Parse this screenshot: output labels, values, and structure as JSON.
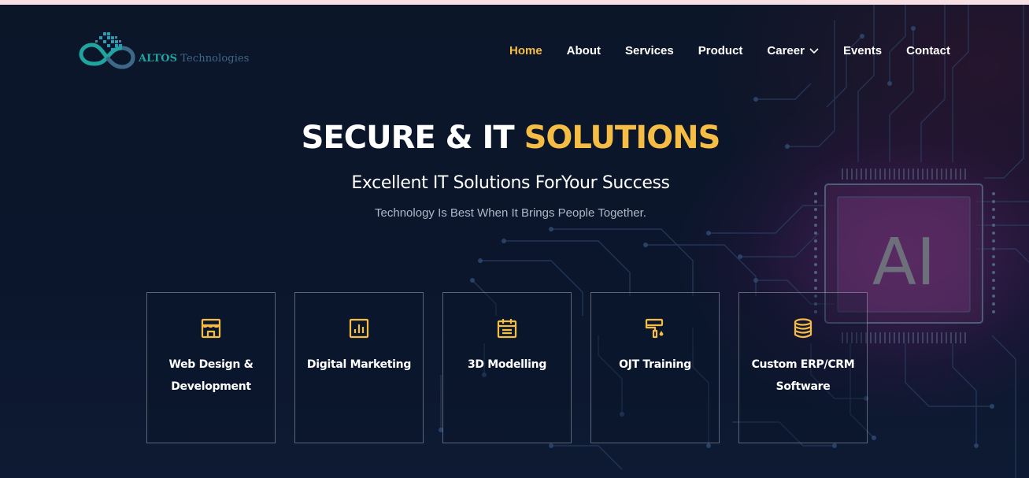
{
  "brand": {
    "name_primary": "ALTOS",
    "name_secondary": "Technologies",
    "logo_icon": "infinity-pixel-logo",
    "colors": {
      "teal": "#1fa4a0",
      "slate": "#3e6887"
    }
  },
  "nav": {
    "items": [
      {
        "label": "Home",
        "active": true
      },
      {
        "label": "About"
      },
      {
        "label": "Services"
      },
      {
        "label": "Product"
      },
      {
        "label": "Career",
        "dropdown": true,
        "icon": "chevron-down-icon"
      },
      {
        "label": "Events"
      },
      {
        "label": "Contact"
      }
    ]
  },
  "hero": {
    "headline_white": "SECURE & IT",
    "headline_accent": "SOLUTIONS",
    "subheading": "Excellent IT Solutions ForYour Success",
    "tagline": "Technology Is Best When It Brings People Together.",
    "chip_label": "AI"
  },
  "services": [
    {
      "title": "Web Design & Development",
      "icon": "storefront-icon"
    },
    {
      "title": "Digital Marketing",
      "icon": "bar-chart-icon"
    },
    {
      "title": "3D Modelling",
      "icon": "calendar-icon"
    },
    {
      "title": "OJT Training",
      "icon": "paint-roller-icon"
    },
    {
      "title": "Custom ERP/CRM Software",
      "icon": "database-icon"
    }
  ],
  "colors": {
    "accent": "#f6bd45",
    "background": "#0b1426",
    "text": "#ffffff",
    "muted": "#aeb8c6",
    "top_strip": "#f7dfe6"
  }
}
